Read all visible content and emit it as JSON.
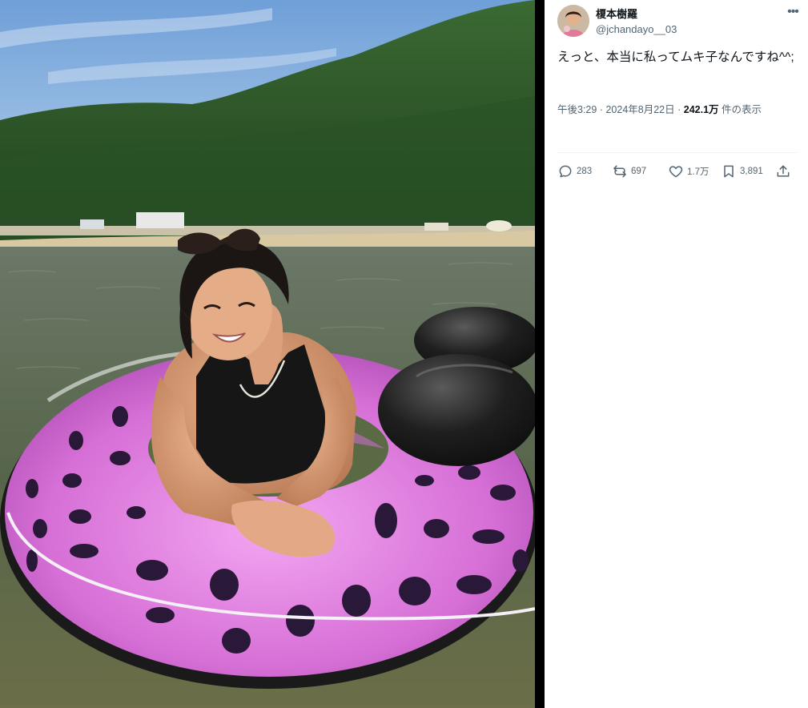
{
  "post": {
    "author": {
      "display_name": "榎本樹羅",
      "handle": "@jchandayo__03",
      "avatar_icon": "profile-photo"
    },
    "more_icon": "more-horizontal-icon",
    "text": "えっと、本当に私ってムキ子なんですね^^;",
    "meta": {
      "time": "午後3:29",
      "date": "2024年8月22日",
      "views_count": "242.1万",
      "views_suffix": "件の表示"
    },
    "actions": [
      {
        "name": "reply",
        "icon": "reply-icon",
        "count": "283"
      },
      {
        "name": "repost",
        "icon": "repost-icon",
        "count": "697"
      },
      {
        "name": "like",
        "icon": "heart-icon",
        "count": "1.7万"
      },
      {
        "name": "bookmark",
        "icon": "bookmark-icon",
        "count": "3,891"
      },
      {
        "name": "share",
        "icon": "share-icon",
        "count": ""
      }
    ]
  },
  "photo": {
    "subject": "woman in a pink watermelon-pattern swim ring at the sea",
    "colors": {
      "sky": "#8fb8e6",
      "mountain": "#2f5a2a",
      "sea": "#5d6b4e",
      "ring_pink": "#d873d8",
      "ring_dark": "#1c1c1c"
    }
  }
}
